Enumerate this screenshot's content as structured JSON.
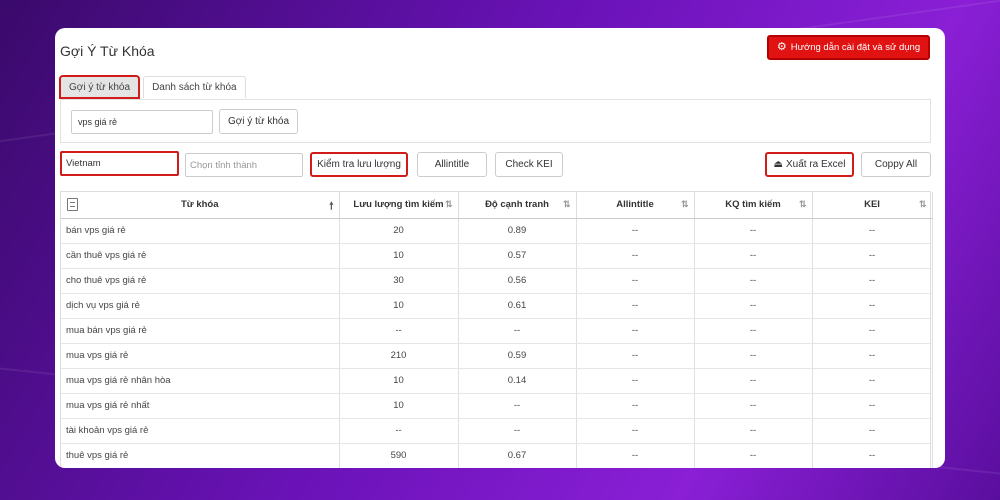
{
  "header": {
    "title": "Gợi Ý Từ Khóa",
    "help_label": "Hướng dẫn cài đặt và sử dụng"
  },
  "tabs": [
    {
      "label": "Gợi ý từ khóa",
      "active": true
    },
    {
      "label": "Danh sách từ khóa",
      "active": false
    }
  ],
  "search": {
    "keyword_value": "vps giá rẻ",
    "suggest_label": "Gợi ý từ khóa"
  },
  "toolbar": {
    "country_value": "Vietnam",
    "province_placeholder": "Chọn tỉnh thành",
    "check_traffic_label": "Kiểm tra lưu lượng",
    "allintitle_label": "Allintitle",
    "check_kei_label": "Check KEI",
    "export_label": "Xuất ra Excel",
    "copy_all_label": "Coppy All"
  },
  "table": {
    "headers": [
      "Từ khóa",
      "Lưu lượng tìm kiếm",
      "Độ cạnh tranh",
      "Allintitle",
      "KQ tìm kiếm",
      "KEI"
    ],
    "rows": [
      [
        "bán vps giá rẻ",
        "20",
        "0.89",
        "--",
        "--",
        "--"
      ],
      [
        "cần thuê vps giá rẻ",
        "10",
        "0.57",
        "--",
        "--",
        "--"
      ],
      [
        "cho thuê vps giá rẻ",
        "30",
        "0.56",
        "--",
        "--",
        "--"
      ],
      [
        "dịch vụ vps giá rẻ",
        "10",
        "0.61",
        "--",
        "--",
        "--"
      ],
      [
        "mua bán vps giá rẻ",
        "--",
        "--",
        "--",
        "--",
        "--"
      ],
      [
        "mua vps giá rẻ",
        "210",
        "0.59",
        "--",
        "--",
        "--"
      ],
      [
        "mua vps giá rẻ nhân hòa",
        "10",
        "0.14",
        "--",
        "--",
        "--"
      ],
      [
        "mua vps giá rẻ nhất",
        "10",
        "--",
        "--",
        "--",
        "--"
      ],
      [
        "tài khoản vps giá rẻ",
        "--",
        "--",
        "--",
        "--",
        "--"
      ],
      [
        "thuê vps giá rẻ",
        "590",
        "0.67",
        "--",
        "--",
        "--"
      ]
    ]
  },
  "colors": {
    "accent_red": "#e01212",
    "highlight_outline": "#d01b1b"
  }
}
